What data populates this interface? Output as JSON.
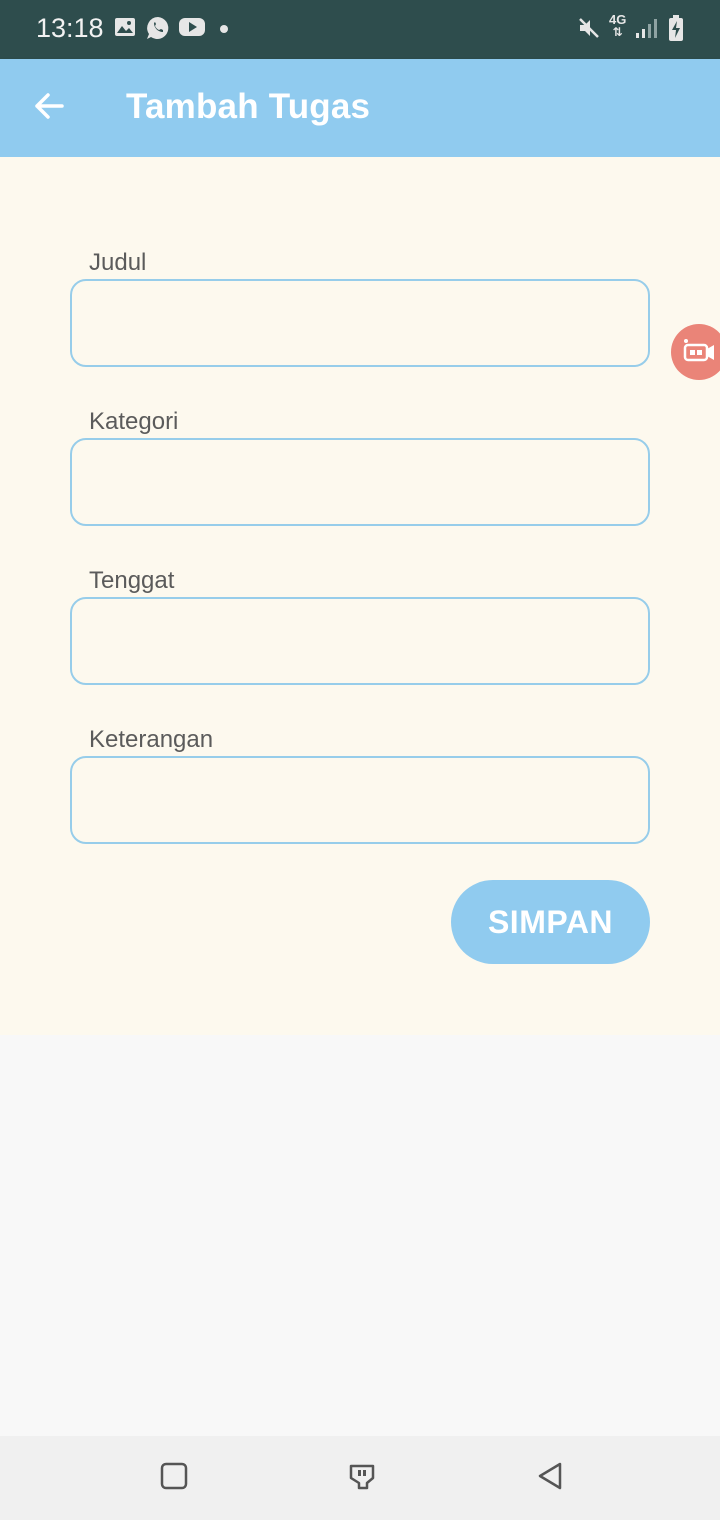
{
  "status_bar": {
    "time": "13:18",
    "left_icons": [
      "gallery-icon",
      "whatsapp-icon",
      "youtube-icon",
      "notification-dot"
    ],
    "right_icons": [
      "mute-icon",
      "4g-signal-icon",
      "signal-bars-icon",
      "battery-charging-icon"
    ],
    "network_label": "4G"
  },
  "app_bar": {
    "back_icon": "arrow-left-icon",
    "title": "Tambah Tugas",
    "color": "#90cbef"
  },
  "form": {
    "fields": [
      {
        "label": "Judul",
        "value": "",
        "placeholder": ""
      },
      {
        "label": "Kategori",
        "value": "",
        "placeholder": ""
      },
      {
        "label": "Tenggat",
        "value": "",
        "placeholder": ""
      },
      {
        "label": "Keterangan",
        "value": "",
        "placeholder": ""
      }
    ],
    "submit_label": "SIMPAN"
  },
  "floating_button": {
    "icon": "screen-record-icon",
    "color": "#ea8478"
  },
  "nav_bar": {
    "buttons": [
      "recent-apps-icon",
      "home-icon",
      "back-triangle-icon"
    ]
  },
  "colors": {
    "accent": "#90cbef",
    "background": "#fdf9ee",
    "status_bar": "#2e4d4d",
    "field_border": "#97cdea"
  }
}
